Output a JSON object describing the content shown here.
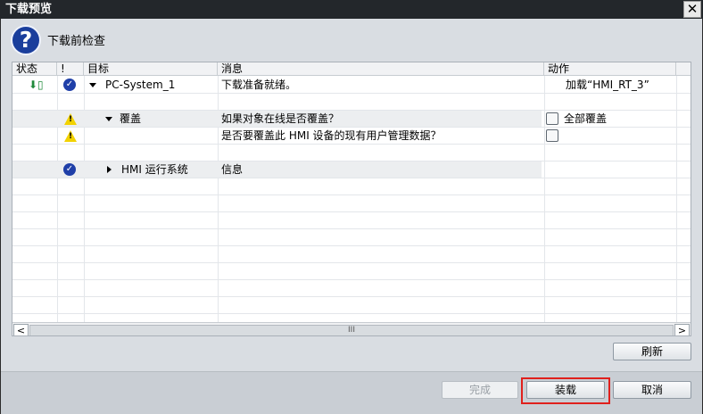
{
  "window": {
    "title": "下载预览",
    "close_label": "✕"
  },
  "header": {
    "title": "下载前检查",
    "icon": "question-icon"
  },
  "table": {
    "columns": [
      "状态",
      "!",
      "目标",
      "消息",
      "动作"
    ],
    "rows": [
      {
        "status_icon": "download-icon",
        "check_icon": "check-warn-icon",
        "expander": "down",
        "target": "PC-System_1",
        "message": "下载准备就绪。",
        "action": "加载“HMI_RT_3”"
      },
      {
        "target": "",
        "message": "",
        "action": ""
      },
      {
        "check_icon": "warning-icon",
        "expander": "down",
        "target": "覆盖",
        "message": "如果对象在线是否覆盖？",
        "action_checkbox": true,
        "action": "全部覆盖",
        "checked": false
      },
      {
        "check_icon": "warning-icon",
        "target": "",
        "message": "是否要覆盖此 HMI 设备的现有用户管理数据？",
        "action_checkbox": true,
        "action": "",
        "checked": false
      },
      {
        "target": "",
        "message": "",
        "action": ""
      },
      {
        "check_icon": "check-icon",
        "expander": "right",
        "target": "HMI 运行系统",
        "message": "信息",
        "action": ""
      }
    ]
  },
  "scrollbar": {
    "left": "<",
    "right": ">",
    "grip": "III"
  },
  "buttons": {
    "refresh": "刷新",
    "finish": "完成",
    "load": "装载",
    "cancel": "取消"
  },
  "colors": {
    "accent": "#1f3fa8",
    "highlight": "#e0201c",
    "warning": "#f2d200"
  }
}
